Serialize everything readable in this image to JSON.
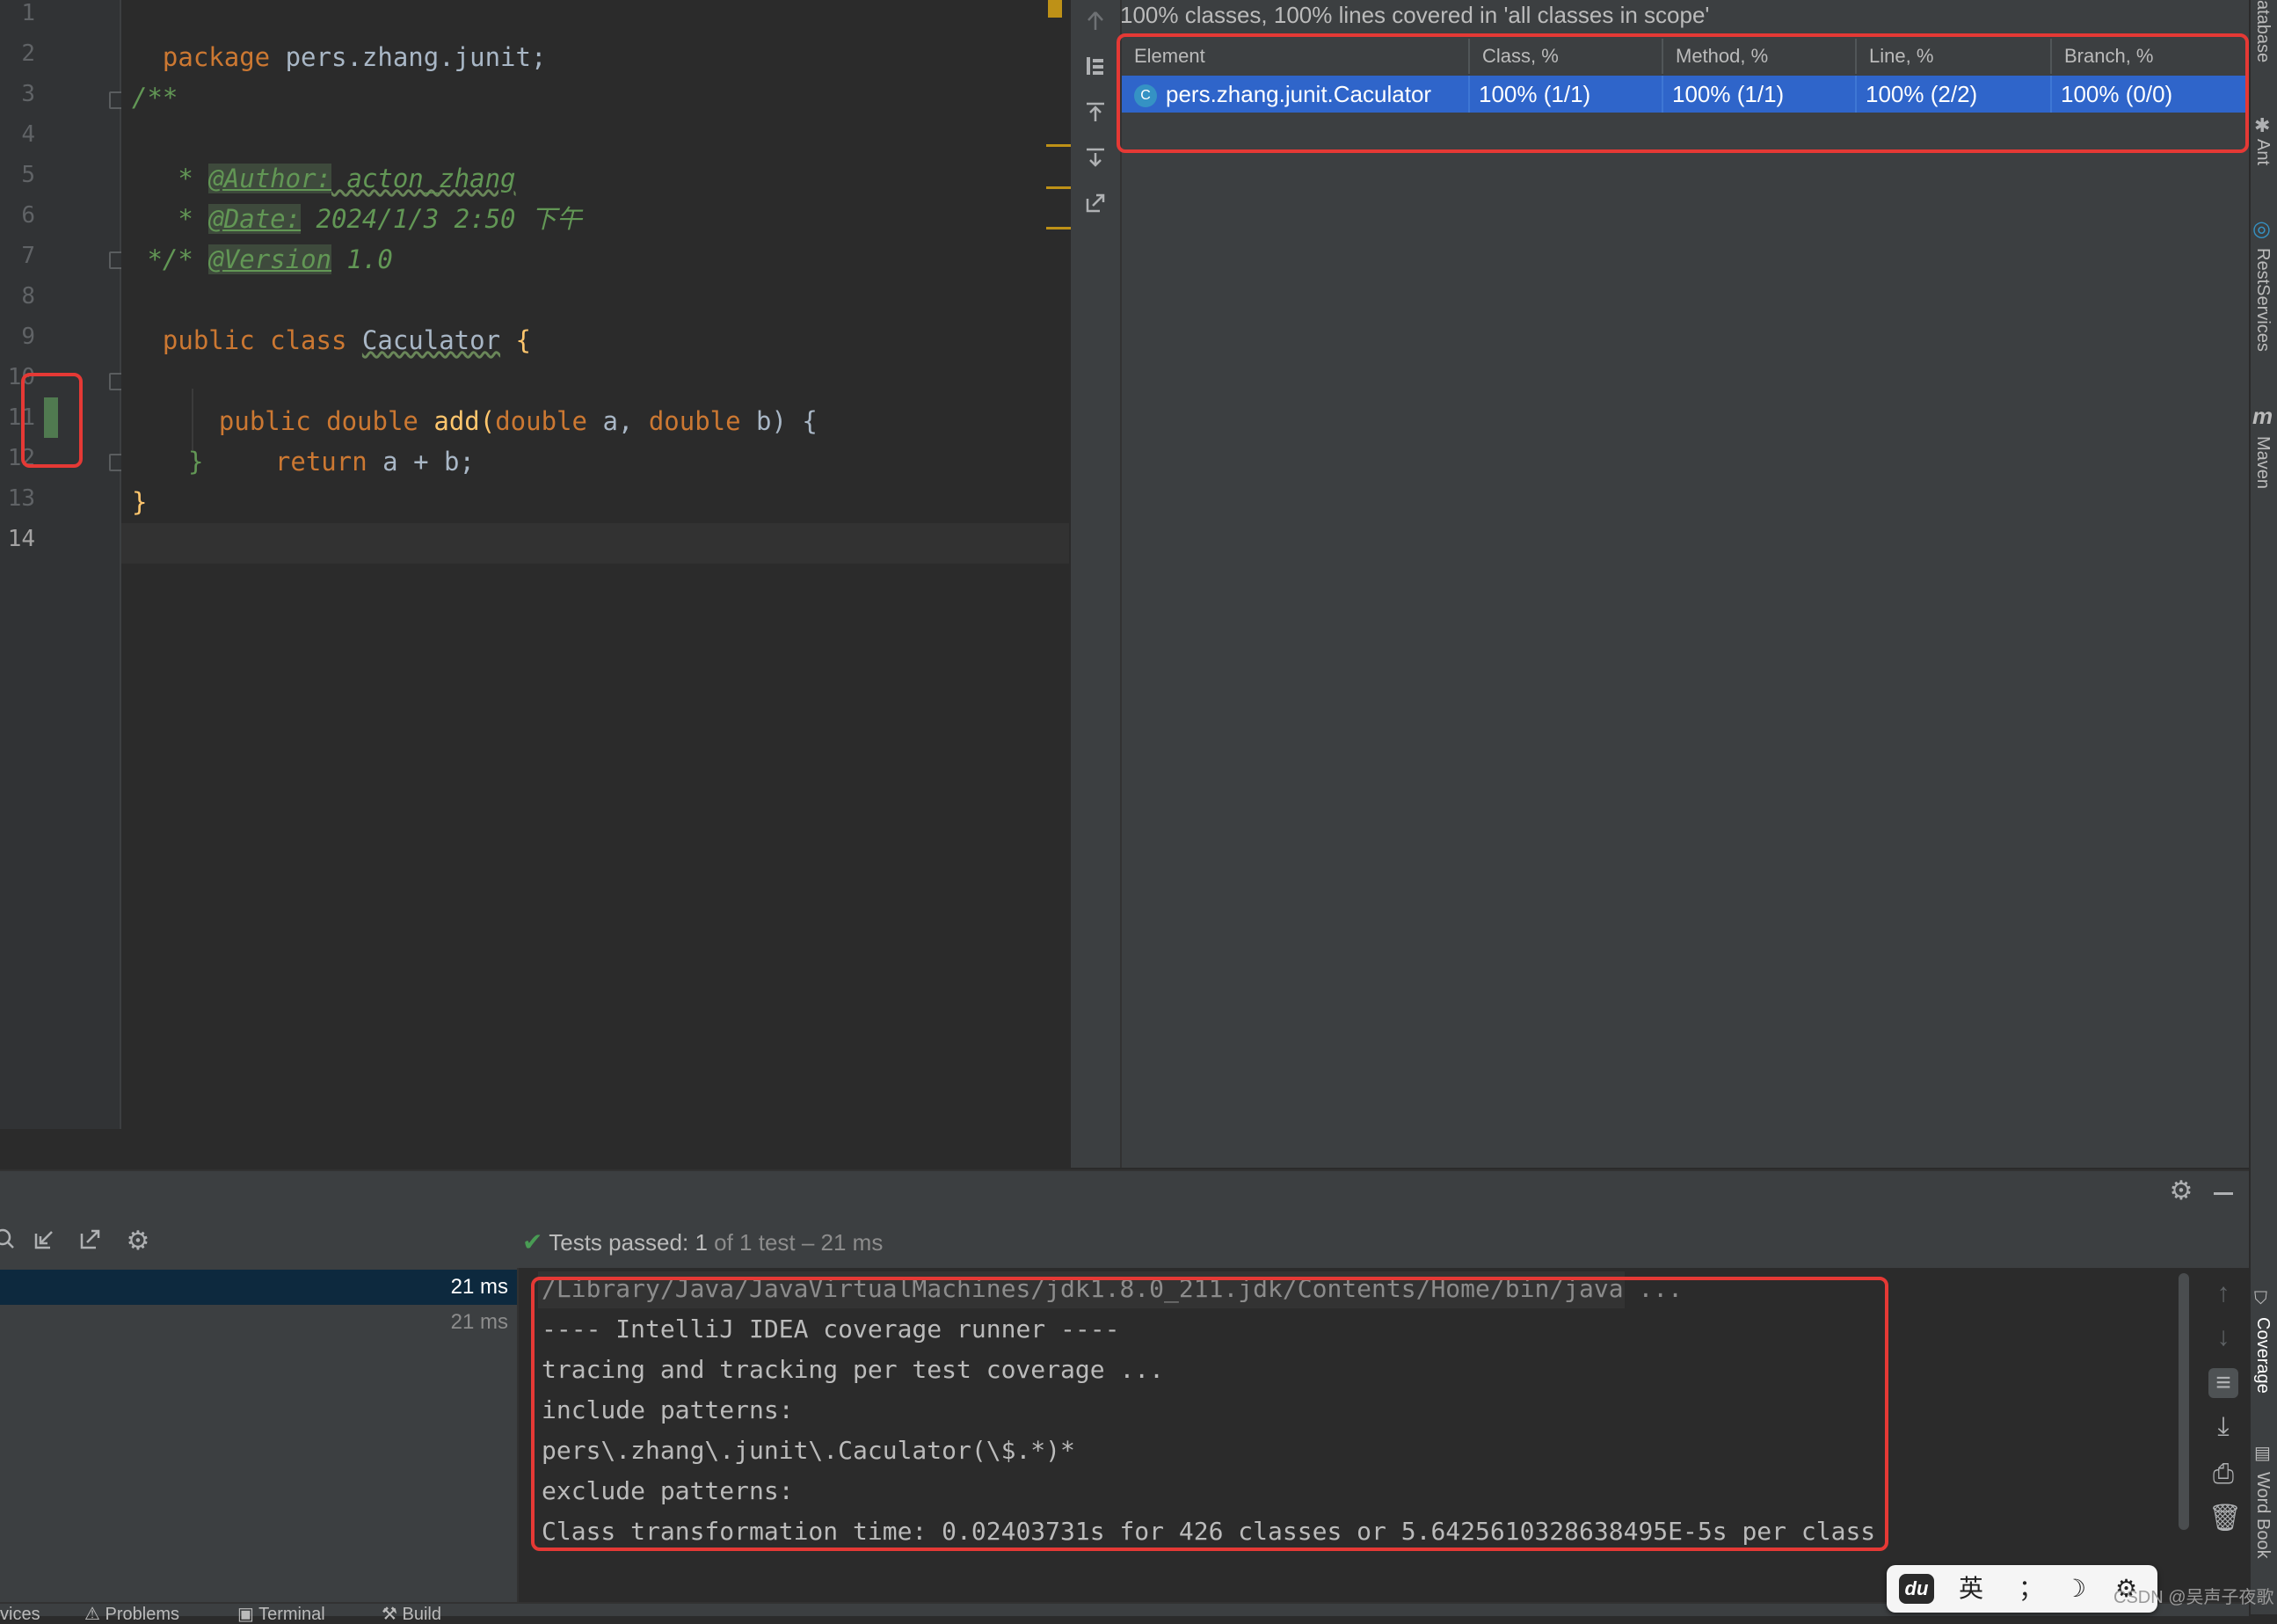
{
  "editor": {
    "line_numbers": [
      "1",
      "2",
      "3",
      "4",
      "5",
      "6",
      "7",
      "8",
      "9",
      "10",
      "11",
      "12",
      "13",
      "14"
    ],
    "line1": {
      "kw": "package",
      "rest": " pers.zhang.junit;"
    },
    "line3": "/**",
    "line4": {
      "star": " * ",
      "tag": "@Author:",
      "val": " acton_zhang"
    },
    "line5": {
      "star": " * ",
      "tag": "@Date:",
      "val": " 2024/1/3 2:50 下午"
    },
    "line6": {
      "star": " * ",
      "tag": "@Version",
      "val": " 1.0"
    },
    "line7": " */",
    "line8": {
      "kw": "public class ",
      "name": "Caculator",
      "rest": " {"
    },
    "line10": {
      "kw1": "public double ",
      "fn": "add",
      "p1": "(",
      "kw2": "double",
      "a": " a, ",
      "kw3": "double",
      "b": " b) {"
    },
    "line11": {
      "kw": "return",
      "rest": " a + b;"
    },
    "line12": "}",
    "line13": "}"
  },
  "coverage": {
    "summary": "100% classes, 100% lines covered in 'all classes in scope'",
    "columns": [
      "Element",
      "Class, %",
      "Method, %",
      "Line, %",
      "Branch, %"
    ],
    "rows": [
      {
        "element": "pers.zhang.junit.Caculator",
        "class": "100% (1/1)",
        "method": "100% (1/1)",
        "line": "100% (2/2)",
        "branch": "100% (0/0)"
      }
    ],
    "class_badge": "C"
  },
  "right_tabs": [
    "atabase",
    "Ant",
    "RestServices",
    "Maven",
    "Coverage",
    "Word Book"
  ],
  "run": {
    "status_bold": "Tests passed: ",
    "status_count": "1",
    "status_rest": " of 1 test – 21 ms",
    "tree": [
      {
        "time": "21 ms",
        "selected": true
      },
      {
        "time": "21 ms",
        "selected": false
      }
    ],
    "console": [
      "/Library/Java/JavaVirtualMachines/jdk1.8.0_211.jdk/Contents/Home/bin/java ...",
      "---- IntelliJ IDEA coverage runner ----",
      "tracing and tracking per test coverage ...",
      "include patterns:",
      "pers\\.zhang\\.junit\\.Caculator(\\$.*)*",
      "exclude patterns:",
      "Class transformation time: 0.02403731s for 426 classes or 5.6425610328638495E-5s per class"
    ]
  },
  "status_bar": {
    "items": [
      "vices",
      "Problems",
      "Terminal",
      "Build"
    ]
  },
  "ime": {
    "logo": "du",
    "lang": "英",
    "punct": "；",
    "moon": "☽",
    "gear": "⚙"
  },
  "watermark": "CSDN @吴声子夜歌",
  "colors": {
    "accent": "#2f65ca",
    "highlight": "#e53935",
    "pass": "#499c54"
  }
}
